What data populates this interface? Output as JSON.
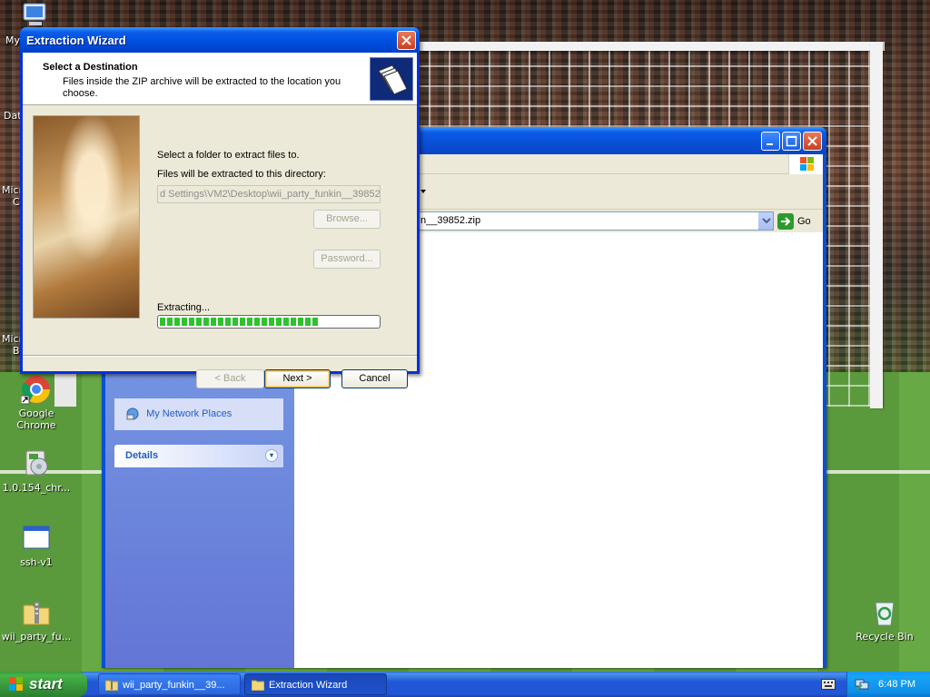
{
  "desktop": {
    "icons": [
      {
        "label": "Google Chrome"
      },
      {
        "label": "1.0.154_chr..."
      },
      {
        "label": "ssh-v1"
      },
      {
        "label": "wii_party_fu..."
      },
      {
        "label": "Recycle Bin"
      }
    ],
    "partial_labels": {
      "my": "My",
      "dat": "Dat",
      "micro1a": "Micro",
      "micro1b": "C",
      "micro2a": "Micro",
      "micro2b": "B"
    }
  },
  "explorer": {
    "address_value": "n__39852.zip",
    "go_label": "Go",
    "task_pane": {
      "network_places": "My Network Places",
      "details_title": "Details"
    }
  },
  "wizard": {
    "title": "Extraction Wizard",
    "header": {
      "title": "Select a Destination",
      "description": "Files inside the ZIP archive will be extracted to the location you choose."
    },
    "select_folder_label": "Select a folder to extract files to.",
    "directory_label": "Files will be extracted to this directory:",
    "directory_value": "d Settings\\VM2\\Desktop\\wii_party_funkin__39852",
    "browse_label": "Browse...",
    "password_label": "Password...",
    "status_label": "Extracting...",
    "progress": 0.73,
    "buttons": {
      "back": "< Back",
      "next": "Next >",
      "cancel": "Cancel"
    }
  },
  "taskbar": {
    "start_label": "start",
    "tasks": [
      {
        "label": "wii_party_funkin__39...",
        "active": false
      },
      {
        "label": "Extraction Wizard",
        "active": true
      }
    ],
    "clock": "6:48 PM"
  },
  "colors": {
    "xp_blue": "#0a4fd6",
    "start_green": "#47b447",
    "progress_green": "#2fc22f"
  }
}
